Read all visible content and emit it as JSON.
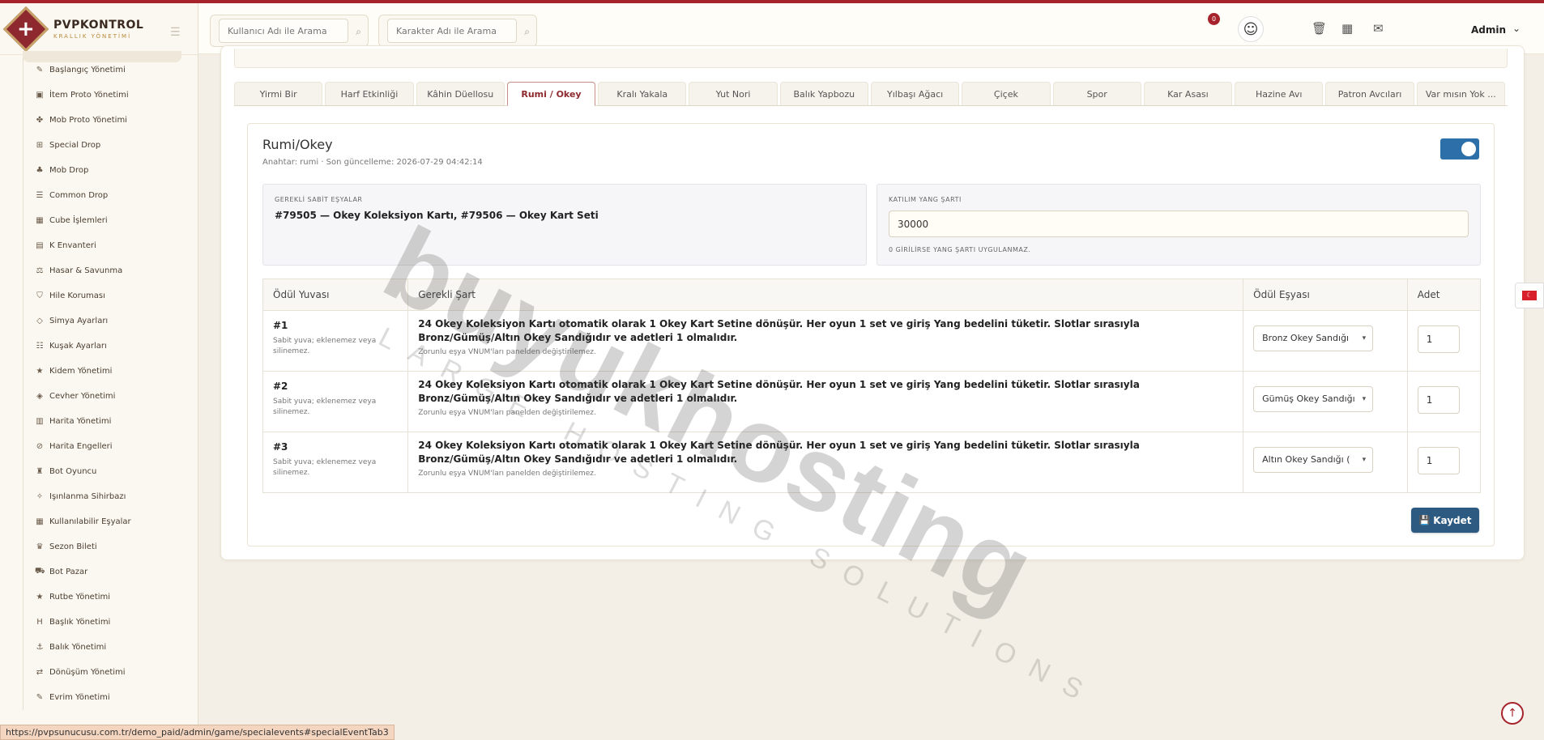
{
  "brand": {
    "title": "PVPKONTROL",
    "subtitle": "KRALLIK YÖNETİMİ"
  },
  "sidebar": {
    "items": [
      {
        "label": "Başlangıç Yönetimi",
        "icon": "wand-icon",
        "glyph": "✎"
      },
      {
        "label": "İtem Proto Yönetimi",
        "icon": "box-icon",
        "glyph": "▣"
      },
      {
        "label": "Mob Proto Yönetimi",
        "icon": "paw-icon",
        "glyph": "✤"
      },
      {
        "label": "Special Drop",
        "icon": "gift-icon",
        "glyph": "⊞"
      },
      {
        "label": "Mob Drop",
        "icon": "ghost-icon",
        "glyph": "♣"
      },
      {
        "label": "Common Drop",
        "icon": "list-icon",
        "glyph": "☰"
      },
      {
        "label": "Cube İşlemleri",
        "icon": "cube-icon",
        "glyph": "▦"
      },
      {
        "label": "K Envanteri",
        "icon": "book-icon",
        "glyph": "▤"
      },
      {
        "label": "Hasar & Savunma",
        "icon": "scale-icon",
        "glyph": "⚖"
      },
      {
        "label": "Hile Koruması",
        "icon": "shield-icon",
        "glyph": "⛉"
      },
      {
        "label": "Simya Ayarları",
        "icon": "gem-icon",
        "glyph": "◇"
      },
      {
        "label": "Kuşak Ayarları",
        "icon": "sliders-icon",
        "glyph": "☷"
      },
      {
        "label": "Kidem Yönetimi",
        "icon": "star-icon",
        "glyph": "★"
      },
      {
        "label": "Cevher Yönetimi",
        "icon": "gem-icon",
        "glyph": "◈"
      },
      {
        "label": "Harita Yönetimi",
        "icon": "map-icon",
        "glyph": "▥"
      },
      {
        "label": "Harita Engelleri",
        "icon": "ban-icon",
        "glyph": "⊘"
      },
      {
        "label": "Bot Oyuncu",
        "icon": "android-icon",
        "glyph": "♜"
      },
      {
        "label": "Işınlanma Sihirbazı",
        "icon": "magic-icon",
        "glyph": "✧"
      },
      {
        "label": "Kullanılabilir Eşyalar",
        "icon": "grid-icon",
        "glyph": "▦"
      },
      {
        "label": "Sezon Bileti",
        "icon": "trophy-icon",
        "glyph": "♛"
      },
      {
        "label": "Bot Pazar",
        "icon": "cart-icon",
        "glyph": "⛟"
      },
      {
        "label": "Rutbe Yönetimi",
        "icon": "star-icon",
        "glyph": "★"
      },
      {
        "label": "Başlık Yönetimi",
        "icon": "heading-icon",
        "glyph": "H"
      },
      {
        "label": "Balık Yönetimi",
        "icon": "anchor-icon",
        "glyph": "⚓"
      },
      {
        "label": "Dönüşüm Yönetimi",
        "icon": "shuffle-icon",
        "glyph": "⇄"
      },
      {
        "label": "Evrim Yönetimi",
        "icon": "wand-icon",
        "glyph": "✎"
      }
    ]
  },
  "header": {
    "search_user_placeholder": "Kullanıcı Adı ile Arama",
    "search_char_placeholder": "Karakter Adı ile Arama",
    "notification_count": "0",
    "user_name": "Admin"
  },
  "tabs": [
    {
      "label": "Yirmi Bir",
      "active": false
    },
    {
      "label": "Harf Etkinliği",
      "active": false
    },
    {
      "label": "Kâhin Düellosu",
      "active": false
    },
    {
      "label": "Rumi / Okey",
      "active": true
    },
    {
      "label": "Kralı Yakala",
      "active": false
    },
    {
      "label": "Yut Nori",
      "active": false
    },
    {
      "label": "Balık Yapbozu",
      "active": false
    },
    {
      "label": "Yılbaşı Ağacı",
      "active": false
    },
    {
      "label": "Çiçek",
      "active": false
    },
    {
      "label": "Spor",
      "active": false
    },
    {
      "label": "Kar Asası",
      "active": false
    },
    {
      "label": "Hazine Avı",
      "active": false
    },
    {
      "label": "Patron Avcıları",
      "active": false
    },
    {
      "label": "Var mısın Yok ...",
      "active": false
    }
  ],
  "event": {
    "title": "Rumi/Okey",
    "meta": "Anahtar: rumi · Son güncelleme: 2026-07-29 04:42:14",
    "enabled": true,
    "required_label": "GEREKLİ SABİT EŞYALAR",
    "required_items": "#79505 — Okey Koleksiyon Kartı, #79506 — Okey Kart Seti",
    "yang_label": "KATILIM YANG ŞARTI",
    "yang_value": "30000",
    "yang_help": "0 GİRİLİRSE YANG ŞARTI UYGULANMAZ.",
    "save_label": "Kaydet"
  },
  "table": {
    "headers": {
      "slot": "Ödül Yuvası",
      "condition": "Gerekli Şart",
      "item": "Ödül Eşyası",
      "qty": "Adet"
    },
    "rows": [
      {
        "slot": "#1",
        "slot_note": "Sabit yuva; eklenemez veya silinemez.",
        "condition": "24 Okey Koleksiyon Kartı otomatik olarak 1 Okey Kart Setine dönüşür. Her oyun 1 set ve giriş Yang bedelini tüketir. Slotlar sırasıyla Bronz/Gümüş/Altın Okey Sandığıdır ve adetleri 1 olmalıdır.",
        "condition_note": "Zorunlu eşya VNUM'ları panelden değiştirilemez.",
        "item": "Bronz Okey Sandığı",
        "qty": "1"
      },
      {
        "slot": "#2",
        "slot_note": "Sabit yuva; eklenemez veya silinemez.",
        "condition": "24 Okey Koleksiyon Kartı otomatik olarak 1 Okey Kart Setine dönüşür. Her oyun 1 set ve giriş Yang bedelini tüketir. Slotlar sırasıyla Bronz/Gümüş/Altın Okey Sandığıdır ve adetleri 1 olmalıdır.",
        "condition_note": "Zorunlu eşya VNUM'ları panelden değiştirilemez.",
        "item": "Gümüş Okey Sandığı",
        "qty": "1"
      },
      {
        "slot": "#3",
        "slot_note": "Sabit yuva; eklenemez veya silinemez.",
        "condition": "24 Okey Koleksiyon Kartı otomatik olarak 1 Okey Kart Setine dönüşür. Her oyun 1 set ve giriş Yang bedelini tüketir. Slotlar sırasıyla Bronz/Gümüş/Altın Okey Sandığıdır ve adetleri 1 olmalıdır.",
        "condition_note": "Zorunlu eşya VNUM'ları panelden değiştirilemez.",
        "item": "Altın Okey Sandığı (",
        "qty": "1"
      }
    ]
  },
  "watermark": {
    "main": "buyukhosting",
    "sub": "LARGE HOSTING SOLUTIONS"
  },
  "status_url": "https://pvpsunucusu.com.tr/demo_paid/admin/game/specialevents#specialEventTab3",
  "colors": {
    "accent": "#a6232c",
    "primary_button": "#2d5a80",
    "toggle_on": "#2d6fa8"
  }
}
